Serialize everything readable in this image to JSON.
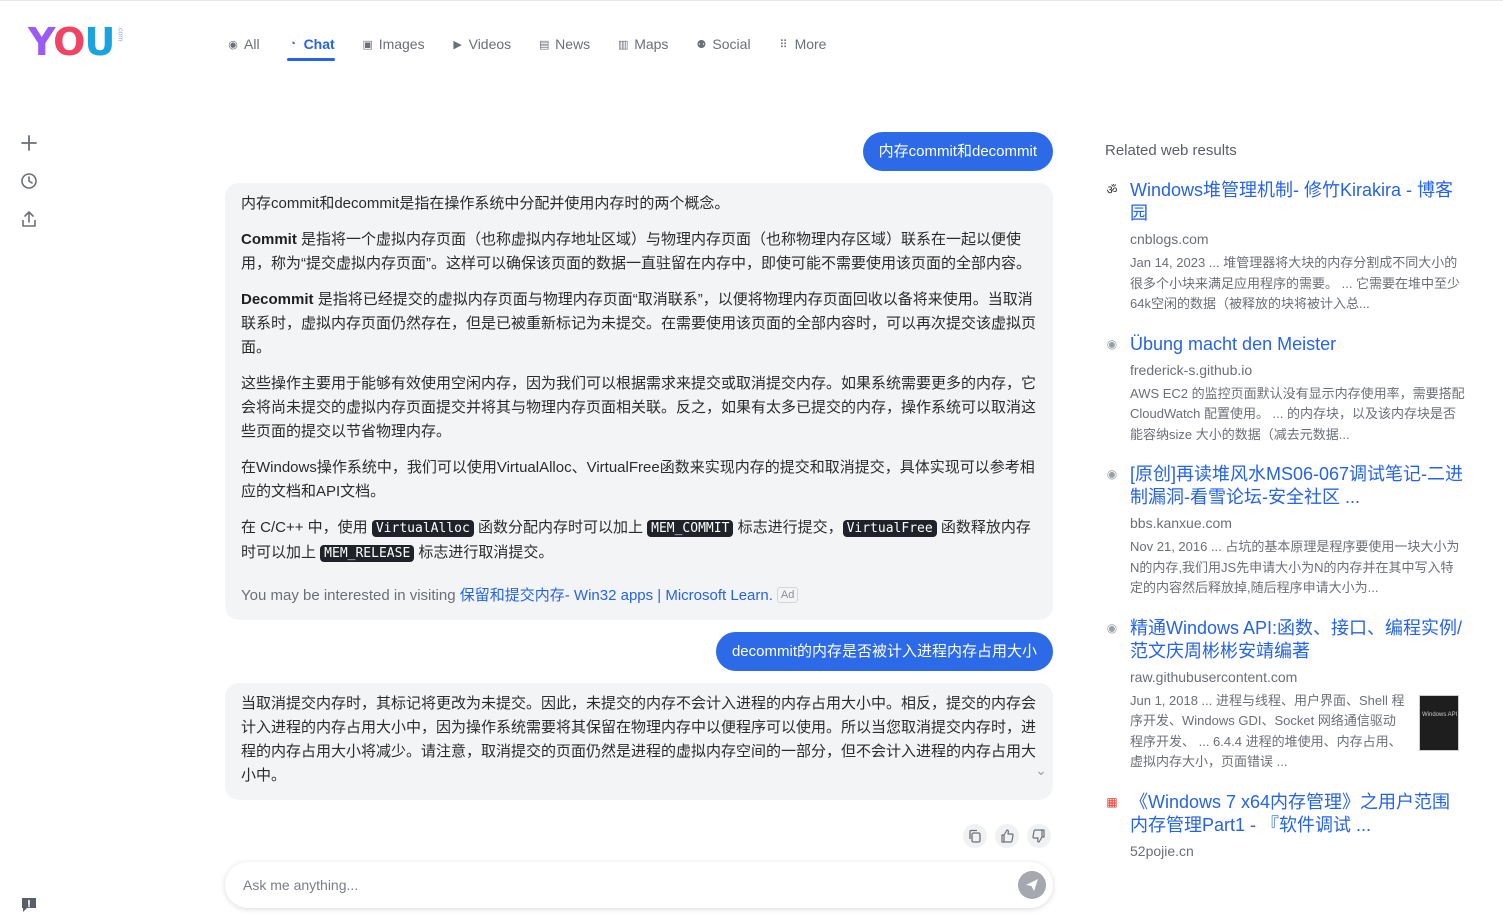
{
  "logo": {
    "text": "YOU",
    "suffix": ".com"
  },
  "nav": {
    "tabs": [
      {
        "label": "All",
        "icon": "search-circle-icon",
        "glyph": "◉"
      },
      {
        "label": "Chat",
        "icon": "chat-icon",
        "glyph": "◔"
      },
      {
        "label": "Images",
        "icon": "images-icon",
        "glyph": "▣"
      },
      {
        "label": "Videos",
        "icon": "play-icon",
        "glyph": "▶"
      },
      {
        "label": "News",
        "icon": "news-icon",
        "glyph": "▤"
      },
      {
        "label": "Maps",
        "icon": "map-icon",
        "glyph": "▥"
      },
      {
        "label": "Social",
        "icon": "people-icon",
        "glyph": "⚉"
      },
      {
        "label": "More",
        "icon": "grid-dots-icon",
        "glyph": "⠿"
      }
    ],
    "active": "Chat"
  },
  "chat": {
    "q1": "内存commit和decommit",
    "a1": {
      "p1": "内存commit和decommit是指在操作系统中分配并使用内存时的两个概念。",
      "p2_b": "Commit",
      "p2": " 是指将一个虚拟内存页面（也称虚拟内存地址区域）与物理内存页面（也称物理内存区域）联系在一起以便使用，称为“提交虚拟内存页面”。这样可以确保该页面的数据一直驻留在内存中，即使可能不需要使用该页面的全部内容。",
      "p3_b": "Decommit",
      "p3": " 是指将已经提交的虚拟内存页面与物理内存页面“取消联系”，以便将物理内存页面回收以备将来使用。当取消联系时，虚拟内存页面仍然存在，但是已被重新标记为未提交。在需要使用该页面的全部内容时，可以再次提交该虚拟页面。",
      "p4": "这些操作主要用于能够有效使用空闲内存，因为我们可以根据需求来提交或取消提交内存。如果系统需要更多的内存，它会将尚未提交的虚拟内存页面提交并将其与物理内存页面相关联。反之，如果有太多已提交的内存，操作系统可以取消这些页面的提交以节省物理内存。",
      "p5": "在Windows操作系统中，我们可以使用VirtualAlloc、VirtualFree函数来实现内存的提交和取消提交，具体实现可以参考相应的文档和API文档。",
      "p6_a": "在 C/C++ 中，使用 ",
      "p6_code1": "VirtualAlloc",
      "p6_b": " 函数分配内存时可以加上 ",
      "p6_code2": "MEM_COMMIT",
      "p6_c": " 标志进行提交，",
      "p6_code3": "VirtualFree",
      "p6_d": " 函数释放内存时可以加上 ",
      "p6_code4": "MEM_RELEASE",
      "p6_e": " 标志进行取消提交。",
      "interest_prefix": "You may be interested in visiting ",
      "interest_link": "保留和提交内存- Win32 apps | Microsoft Learn.",
      "ad": "Ad"
    },
    "q2": "decommit的内存是否被计入进程内存占用大小",
    "a2": {
      "p1": "当取消提交内存时，其标记将更改为未提交。因此，未提交的内存不会计入进程的内存占用大小中。相反，提交的内存会计入进程的内存占用大小中，因为操作系统需要将其保留在物理内存中以便程序可以使用。所以当您取消提交内存时，进程的内存占用大小将减少。请注意，取消提交的页面仍然是进程的虚拟内存空间的一部分，但不会计入进程的内存占用大小中。"
    }
  },
  "input": {
    "placeholder": "Ask me anything..."
  },
  "related": {
    "heading": "Related web results",
    "results": [
      {
        "title": "Windows堆管理机制- 修竹Kirakira - 博客园",
        "domain": "cnblogs.com",
        "snippet": "Jan 14, 2023 ... 堆管理器将大块的内存分割成不同大小的很多个小块来满足应用程序的需要。 ... 它需要在堆中至少64k空闲的数据（被释放的块将被计入总...",
        "favicon": "cnblogs-favicon-icon"
      },
      {
        "title": "Übung macht den Meister",
        "domain": "frederick-s.github.io",
        "snippet": "AWS EC2 的监控页面默认没有显示内存使用率，需要搭配 CloudWatch 配置使用。 ... 的内存块，以及该内存块是否能容纳size 大小的数据（减去元数据...",
        "favicon": "globe-icon"
      },
      {
        "title": "[原创]再读堆风水MS06-067调试笔记-二进制漏洞-看雪论坛-安全社区 ...",
        "domain": "bbs.kanxue.com",
        "snippet": "Nov 21, 2016 ... 占坑的基本原理是程序要使用一块大小为N的内存,我们用JS先申请大小为N的内存并在其中写入特定的内容然后释放掉,随后程序申请大小为...",
        "favicon": "globe-icon"
      },
      {
        "title": "精通Windows API:函数、接口、编程实例/范文庆周彬彬安靖编著",
        "domain": "raw.githubusercontent.com",
        "snippet": "Jun 1, 2018 ... 进程与线程、用户界面、Shell 程序开发、Windows GDI、Socket 网络通信驱动程序开发、 ... 6.4.4 进程的堆使用、内存占用、虚拟内存大小，页面错误 ...",
        "favicon": "globe-icon"
      },
      {
        "title": "《Windows 7 x64内存管理》之用户范围内存管理Part1 - 『软件调试 ...",
        "domain": "52pojie.cn",
        "snippet": "",
        "favicon": "52pojie-favicon-icon"
      }
    ]
  },
  "colors": {
    "accent": "#2563eb",
    "user_bubble": "#2c6ae8",
    "bot_bubble": "#f3f4f6"
  }
}
